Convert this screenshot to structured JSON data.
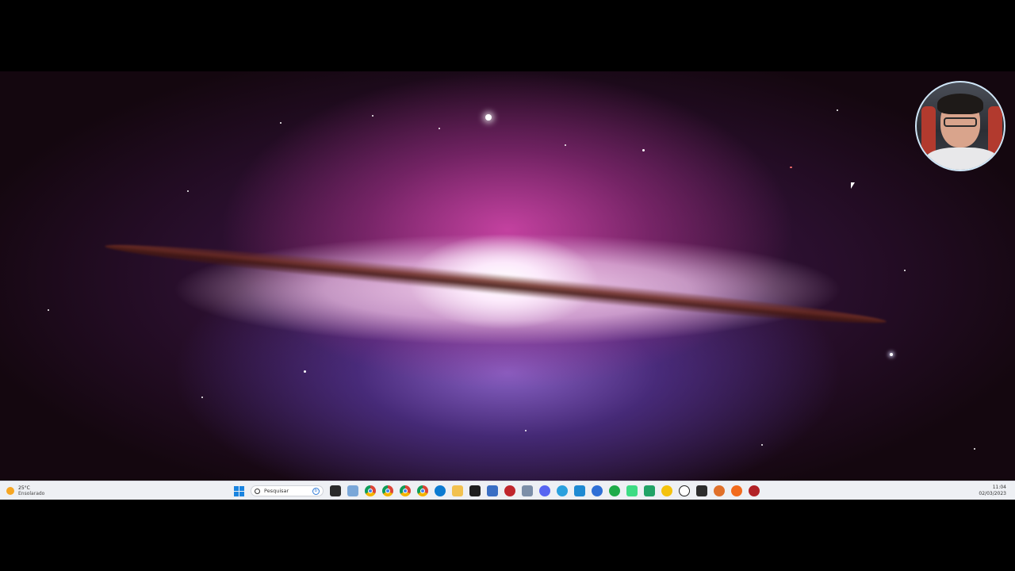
{
  "taskbar": {
    "weather": {
      "temperature": "25°C",
      "condition": "Ensolarado",
      "icon": "sun-icon"
    },
    "search": {
      "placeholder": "Pesquisar"
    },
    "start_icon": "windows-icon",
    "pinned_apps": [
      {
        "name": "task-view-icon",
        "color": "#2b2b2b"
      },
      {
        "name": "widgets-icon",
        "color": "#7aa7d8"
      },
      {
        "name": "chrome-icon",
        "color": "#db4437"
      },
      {
        "name": "chrome-profile-icon",
        "color": "#0f9d58"
      },
      {
        "name": "chrome-profile-icon",
        "color": "#4285f4"
      },
      {
        "name": "chrome-profile-icon",
        "color": "#f4b400"
      },
      {
        "name": "chrome-profile-icon",
        "color": "#db4437"
      },
      {
        "name": "edge-icon",
        "color": "#0c7bd1"
      },
      {
        "name": "file-explorer-icon",
        "color": "#f2c14e"
      },
      {
        "name": "terminal-icon",
        "color": "#1e1e1e"
      },
      {
        "name": "puzzle-icon",
        "color": "#3a6fc4"
      },
      {
        "name": "rad-studio-icon",
        "color": "#c0262d"
      },
      {
        "name": "git-icon",
        "color": "#7d8fa8"
      },
      {
        "name": "discord-icon",
        "color": "#5865f2"
      },
      {
        "name": "telegram-icon",
        "color": "#2aa1de"
      },
      {
        "name": "vscode-icon",
        "color": "#1f8ad2"
      },
      {
        "name": "maps-icon",
        "color": "#2f6fd6"
      },
      {
        "name": "evernote-icon",
        "color": "#1fab49"
      },
      {
        "name": "android-studio-icon",
        "color": "#3ddc84"
      },
      {
        "name": "spreadsheet-icon",
        "color": "#21a366"
      },
      {
        "name": "google-icon",
        "color": "#f4c20d"
      },
      {
        "name": "soccer-icon",
        "color": "#222222"
      },
      {
        "name": "camera-icon",
        "color": "#2d2d2d"
      },
      {
        "name": "search-tool-icon",
        "color": "#e0702a"
      },
      {
        "name": "slash-icon",
        "color": "#f26b1d"
      },
      {
        "name": "rad-studio-icon",
        "color": "#b22227"
      }
    ],
    "clock": {
      "time": "11:04",
      "date": "02/03/2023"
    }
  },
  "accent_colors": {
    "taskbar": "#eef0f4",
    "windows_blue": "#1a84e0"
  }
}
